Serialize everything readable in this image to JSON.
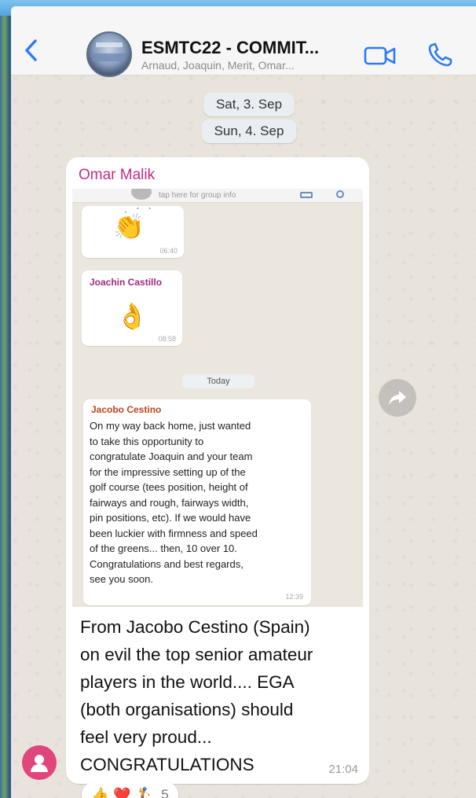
{
  "header": {
    "title": "ESMTC22 - COMMIT...",
    "subtitle": "Arnaud, Joaquin, Merit, Omar..."
  },
  "dates": [
    "Sat, 3. Sep",
    "Sun, 4. Sep"
  ],
  "message": {
    "sender": "Omar Malik",
    "caption": "From Jacobo Cestino (Spain)\non evil the top senior amateur\nplayers in the world.... EGA\n(both organisations) should\nfeel very proud...\nCONGRATULATIONS",
    "time": "21:04",
    "embedded": {
      "top_tip": "tap here for group info",
      "clap_time": "06:40",
      "ok_sender": "Joachin Castillo",
      "ok_time": "08:58",
      "today_label": "Today",
      "quote_sender": "Jacobo Cestino",
      "quote_text": "On my way back home, just wanted\nto take this opportunity to\ncongratulate Joaquin and your team\nfor the impressive setting up of the\ngolf course (tees position, height of\nfairways and rough, fairways width,\npin positions, etc). If we would have\nbeen luckier with firmness and speed\nof the greens... then, 10 over 10.\nCongratulations and best regards,\nsee you soon.",
      "quote_time": "12:39"
    },
    "reactions": {
      "emojis": [
        "👍",
        "❤️",
        "🏌"
      ],
      "count": "5"
    }
  },
  "colors": {
    "accent": "#2f7bf6",
    "sender_name": "#c42b87",
    "avatar_pink": "#e0457b"
  }
}
